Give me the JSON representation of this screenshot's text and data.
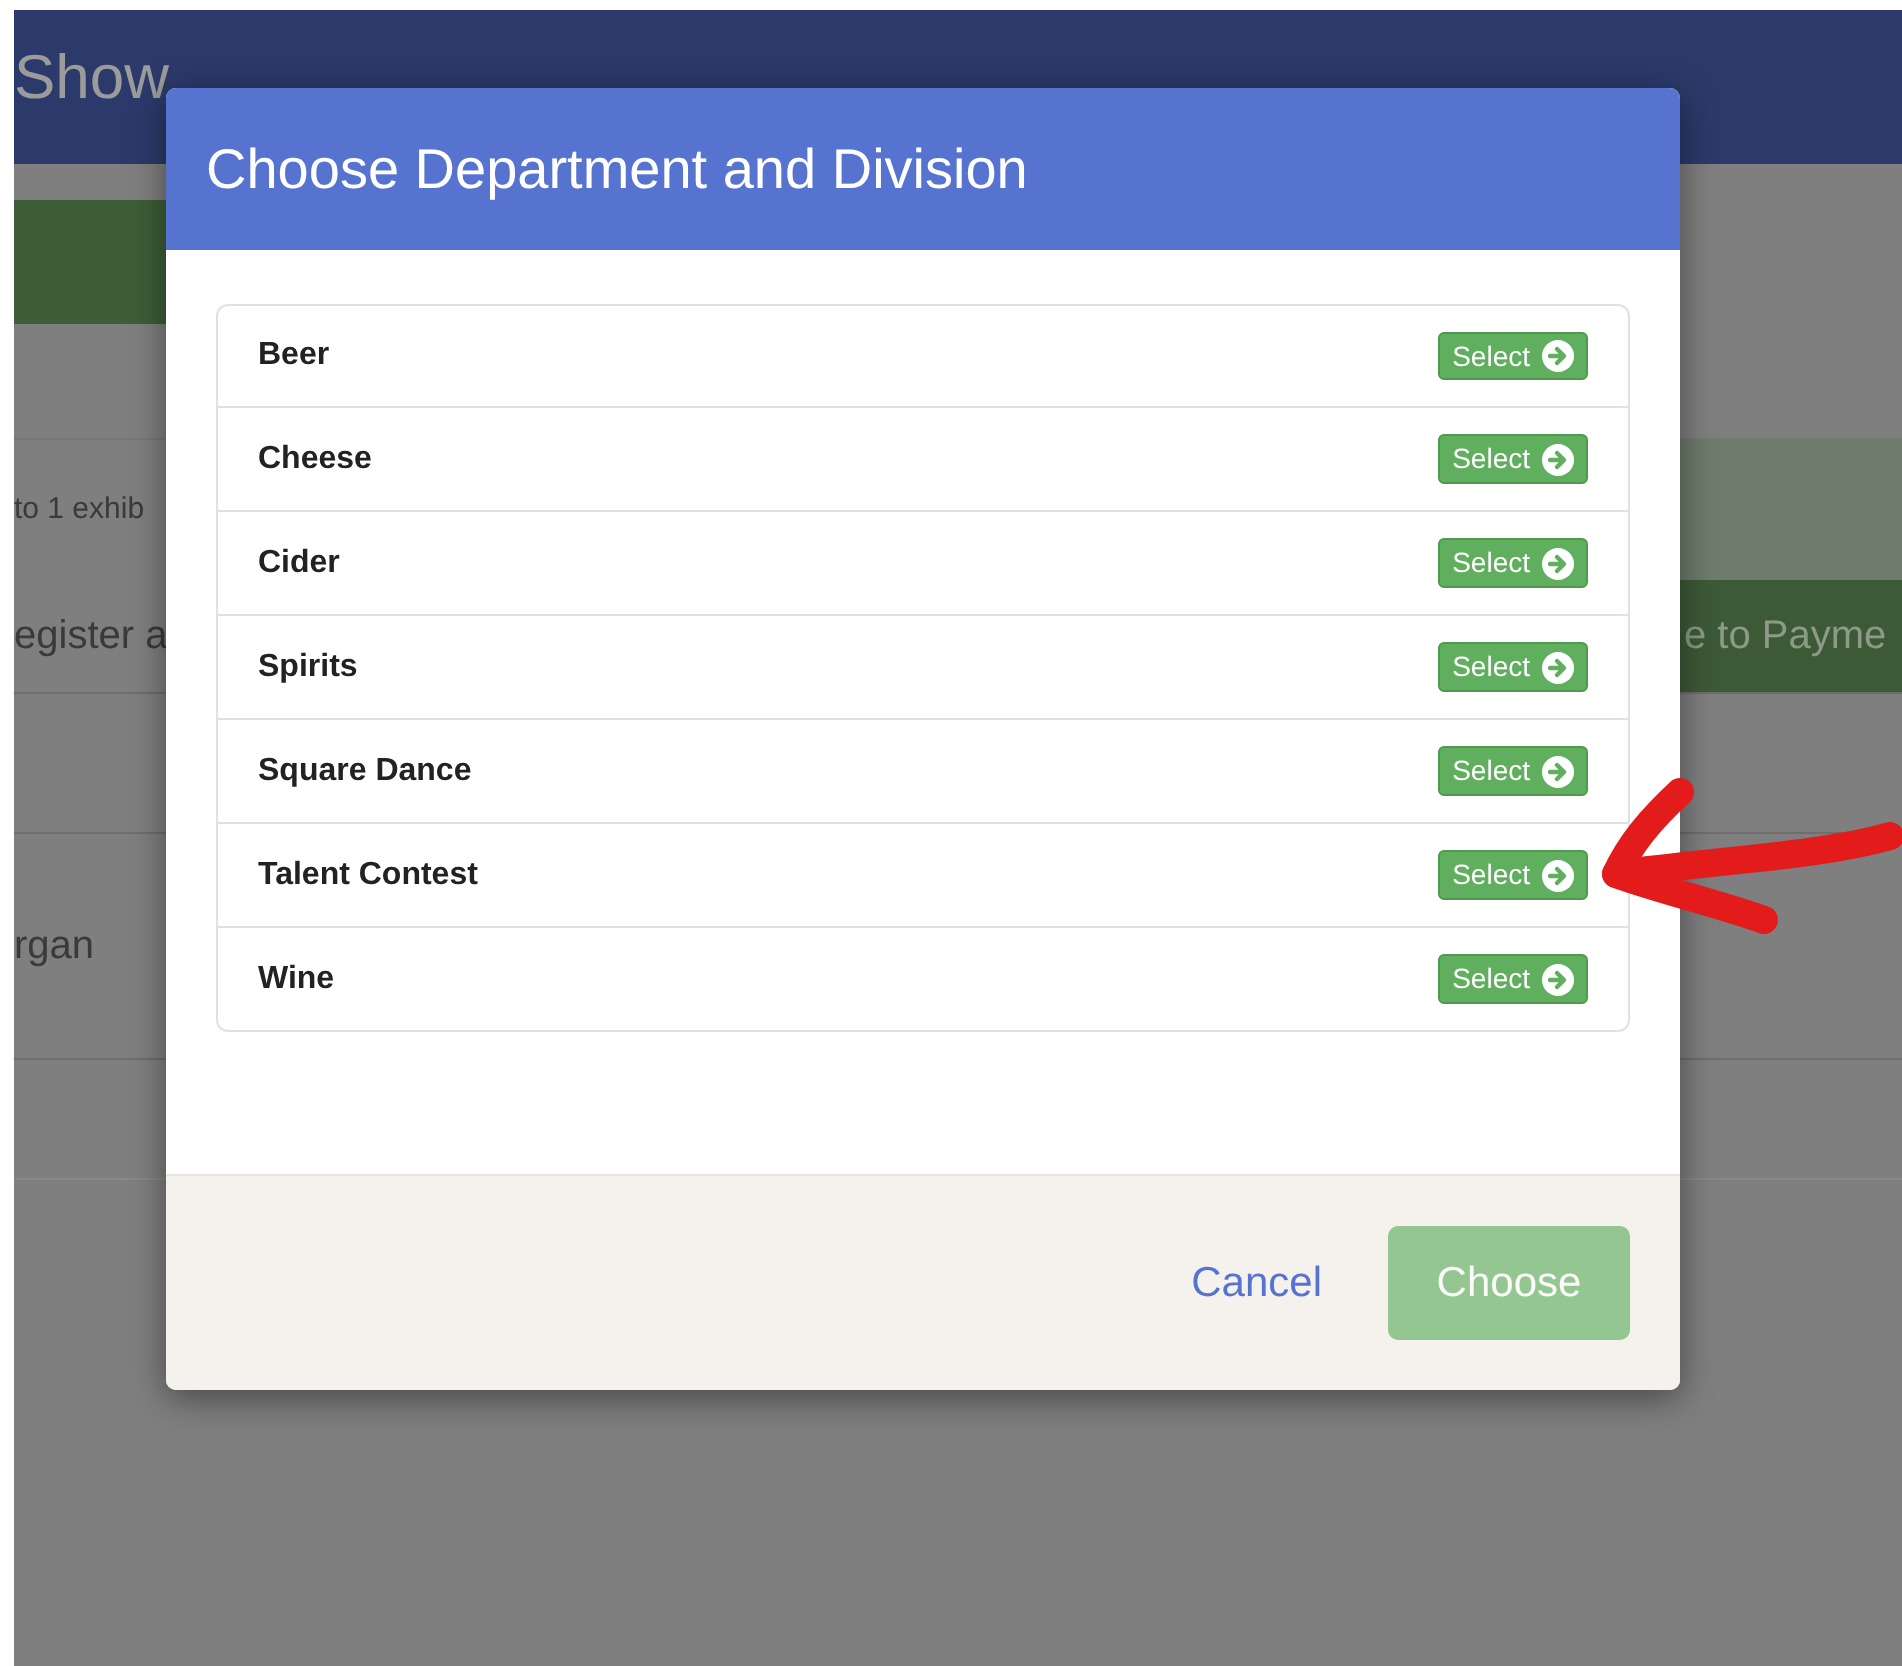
{
  "background_page": {
    "title": "Show",
    "notice_text": "to 1 exhib",
    "register_text": "egister a",
    "payment_button": "e to Payme",
    "name_text": "rgan"
  },
  "modal": {
    "title": "Choose Department and Division",
    "departments": [
      {
        "label": "Beer",
        "button": "Select"
      },
      {
        "label": "Cheese",
        "button": "Select"
      },
      {
        "label": "Cider",
        "button": "Select"
      },
      {
        "label": "Spirits",
        "button": "Select"
      },
      {
        "label": "Square Dance",
        "button": "Select"
      },
      {
        "label": "Talent Contest",
        "button": "Select"
      },
      {
        "label": "Wine",
        "button": "Select"
      }
    ],
    "footer": {
      "cancel": "Cancel",
      "choose": "Choose",
      "choose_disabled": true
    }
  },
  "annotation": {
    "kind": "arrow"
  }
}
